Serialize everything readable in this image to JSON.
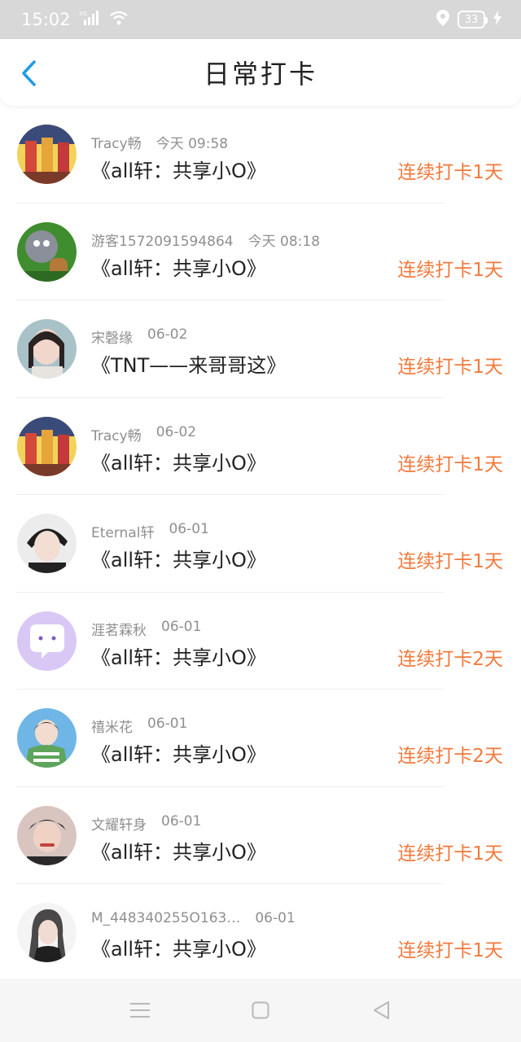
{
  "status_bar": {
    "time": "15:02",
    "network": "3G",
    "battery": "33"
  },
  "header": {
    "title": "日常打卡",
    "back_icon": "chevron-left-icon"
  },
  "colors": {
    "accent": "#1e9be8",
    "streak": "#f27a3c"
  },
  "checkins": [
    {
      "user": "Tracy畅",
      "time": "今天  09:58",
      "group": "《all轩：共享小O》",
      "streak": "连续打卡1天"
    },
    {
      "user": "游客15720915948​64",
      "time": "今天  08:18",
      "group": "《all轩：共享小O》",
      "streak": "连续打卡1天"
    },
    {
      "user": "宋磬缘",
      "time": "06-02",
      "group": "《TNT——来哥哥这》",
      "streak": "连续打卡1天"
    },
    {
      "user": "Tracy畅",
      "time": "06-02",
      "group": "《all轩：共享小O》",
      "streak": "连续打卡1天"
    },
    {
      "user": "Eternal轩",
      "time": "06-01",
      "group": "《all轩：共享小O》",
      "streak": "连续打卡1天"
    },
    {
      "user": "涯茗霖秋",
      "time": "06-01",
      "group": "《all轩：共享小O》",
      "streak": "连续打卡2天"
    },
    {
      "user": "禧米花",
      "time": "06-01",
      "group": "《all轩：共享小O》",
      "streak": "连续打卡2天"
    },
    {
      "user": "文耀轩身",
      "time": "06-01",
      "group": "《all轩：共享小O》",
      "streak": "连续打卡1天"
    },
    {
      "user": "M_448340255O163…",
      "time": "06-01",
      "group": "《all轩：共享小O》",
      "streak": "连续打卡1天"
    }
  ],
  "nav": {
    "menu_icon": "menu-icon",
    "home_icon": "square-home-icon",
    "back_icon": "triangle-back-icon"
  }
}
